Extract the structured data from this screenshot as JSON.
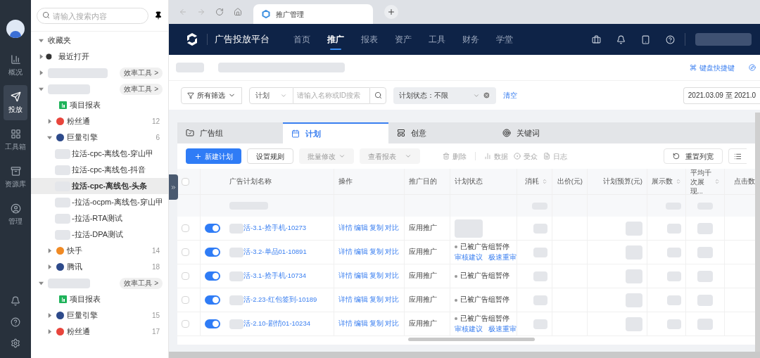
{
  "rail": {
    "items": [
      {
        "label": "概况",
        "selected": false
      },
      {
        "label": "投放",
        "selected": true
      },
      {
        "label": "工具箱",
        "selected": false
      },
      {
        "label": "资源库",
        "selected": false
      },
      {
        "label": "管理",
        "selected": false
      }
    ]
  },
  "tree": {
    "search": {
      "placeholder": "请输入搜索内容"
    },
    "nodes": [
      {
        "kind": "group",
        "label": "收藏夹",
        "expanded": true
      },
      {
        "kind": "recent",
        "label": "最近打开",
        "expanded": false
      },
      {
        "kind": "account",
        "expanded": false,
        "tool": "效率工具 >"
      },
      {
        "kind": "account",
        "expanded": true,
        "tool": "效率工具 >",
        "children": [
          {
            "kind": "report",
            "label": "项目报表"
          },
          {
            "kind": "media",
            "label": "粉丝通",
            "color": "#e8453c",
            "count": "12",
            "expanded": false
          },
          {
            "kind": "media",
            "label": "巨量引擎",
            "color": "#2d4a8a",
            "count": "6",
            "expanded": true,
            "children": [
              {
                "kind": "plan",
                "label": "拉活-cpc-离线包-穿山甲",
                "selected": false
              },
              {
                "kind": "plan",
                "label": "拉活-cpc-离线包-抖音",
                "selected": false
              },
              {
                "kind": "plan",
                "label": "拉活-cpc-离线包-头条",
                "selected": true
              },
              {
                "kind": "plan",
                "label": "-拉活-ocpm-离线包-穿山甲",
                "selected": false
              },
              {
                "kind": "plan",
                "label": "-拉活-RTA测试",
                "selected": false
              },
              {
                "kind": "plan",
                "label": "-拉活-DPA测试",
                "selected": false
              }
            ]
          },
          {
            "kind": "media",
            "label": "快手",
            "color": "#f08a24",
            "count": "14",
            "expanded": false
          },
          {
            "kind": "media",
            "label": "腾讯",
            "color": "#2d4a8a",
            "count": "18",
            "expanded": false
          }
        ]
      },
      {
        "kind": "account",
        "expanded": true,
        "tool": "效率工具 >",
        "children": [
          {
            "kind": "report",
            "label": "项目报表"
          },
          {
            "kind": "media",
            "label": "巨量引擎",
            "color": "#2d4a8a",
            "count": "15",
            "expanded": false
          },
          {
            "kind": "media",
            "label": "粉丝通",
            "color": "#e8453c",
            "count": "17",
            "expanded": false
          }
        ]
      }
    ]
  },
  "browser": {
    "tab": "推广管理"
  },
  "nav": {
    "title": "广告投放平台",
    "items": [
      {
        "label": "首页",
        "selected": false
      },
      {
        "label": "推广",
        "selected": true
      },
      {
        "label": "报表",
        "selected": false
      },
      {
        "label": "资产",
        "selected": false
      },
      {
        "label": "工具",
        "selected": false
      },
      {
        "label": "财务",
        "selected": false
      },
      {
        "label": "学堂",
        "selected": false
      }
    ]
  },
  "header": {
    "shortcut": "键盘快捷键"
  },
  "filters": {
    "all": "所有筛选",
    "level": "计划",
    "search_placeholder": "请输入名称或ID搜索",
    "status": "计划状态：不限",
    "clear": "清空",
    "date": "2021.03.09 至 2021.0"
  },
  "tabs": [
    {
      "label": "广告组",
      "selected": false
    },
    {
      "label": "计划",
      "selected": true
    },
    {
      "label": "创意",
      "selected": false
    },
    {
      "label": "关键词",
      "selected": false
    }
  ],
  "toolbar": {
    "create": "新建计划",
    "rules": "设置规则",
    "batch": "批量修改",
    "report": "查看报表",
    "delete": "删除",
    "data": "数据",
    "audience": "受众",
    "log": "日志",
    "reset": "重置列宽"
  },
  "table": {
    "all_checked": false,
    "columns": [
      "广告计划名称",
      "操作",
      "推广目的",
      "计划状态",
      "消耗",
      "出价(元)",
      "计划预算(元)",
      "展示数",
      "平均千次展现...",
      "点击数"
    ],
    "rows": [
      {
        "checked": false,
        "on": true,
        "name": "活-3.1-抢手机-10273",
        "actions": [
          "详情",
          "编辑",
          "复制",
          "对比"
        ],
        "purpose": "应用推广"
      },
      {
        "checked": false,
        "on": true,
        "name": "活-3.2-单品01-10891",
        "actions": [
          "详情",
          "编辑",
          "复制",
          "对比"
        ],
        "purpose": "应用推广",
        "status": "已被广告组暂停",
        "links": [
          "审核建议",
          "极速重审"
        ]
      },
      {
        "checked": false,
        "on": true,
        "name": "活-3.1-抢手机-10734",
        "actions": [
          "详情",
          "编辑",
          "复制",
          "对比"
        ],
        "purpose": "应用推广",
        "status": "已被广告组暂停"
      },
      {
        "checked": false,
        "on": true,
        "name": "活-2.23-红包签到-10189",
        "actions": [
          "详情",
          "编辑",
          "复制",
          "对比"
        ],
        "purpose": "应用推广",
        "status": "已被广告组暂停"
      },
      {
        "checked": false,
        "on": true,
        "name": "活-2.10-剧情01-10234",
        "actions": [
          "详情",
          "编辑",
          "复制",
          "对比"
        ],
        "purpose": "应用推广",
        "status": "已被广告组暂停",
        "links": [
          "审核建议",
          "极速重审"
        ]
      }
    ]
  }
}
